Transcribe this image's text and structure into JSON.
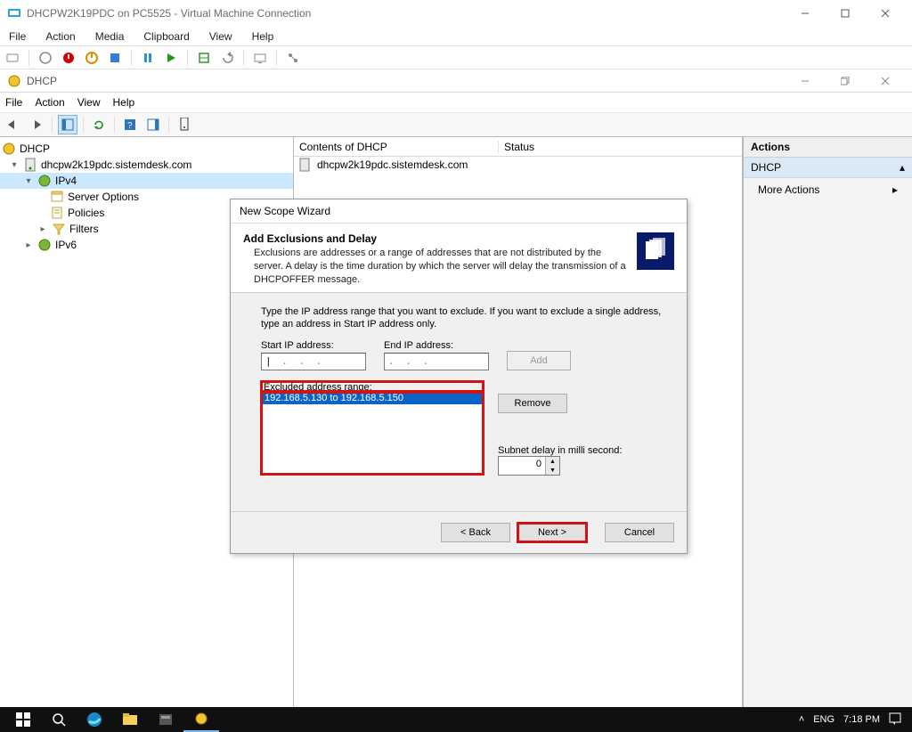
{
  "vm": {
    "title": "DHCPW2K19PDC on PC5525 - Virtual Machine Connection",
    "menu": [
      "File",
      "Action",
      "Media",
      "Clipboard",
      "View",
      "Help"
    ]
  },
  "dhcp": {
    "title": "DHCP",
    "menu": [
      "File",
      "Action",
      "View",
      "Help"
    ],
    "tree": {
      "root": "DHCP",
      "server": "dhcpw2k19pdc.sistemdesk.com",
      "ipv4": "IPv4",
      "server_options": "Server Options",
      "policies": "Policies",
      "filters": "Filters",
      "ipv6": "IPv6"
    },
    "content": {
      "header_col1": "Contents of DHCP",
      "header_col2": "Status",
      "row1": "dhcpw2k19pdc.sistemdesk.com"
    },
    "actions": {
      "title": "Actions",
      "section": "DHCP",
      "more": "More Actions"
    }
  },
  "wizard": {
    "title": "New Scope Wizard",
    "heading": "Add Exclusions and Delay",
    "desc": "Exclusions are addresses or a range of addresses that are not distributed by the server. A delay is the time duration by which the server will delay the transmission of a DHCPOFFER message.",
    "instruction": "Type the IP address range that you want to exclude. If you want to exclude a single address, type an address in Start IP address only.",
    "start_label": "Start IP address:",
    "end_label": "End IP address:",
    "add": "Add",
    "list_label": "Excluded address range:",
    "excluded": "192.168.5.130 to 192.168.5.150",
    "remove": "Remove",
    "subnet_label": "Subnet delay in milli second:",
    "subnet_value": "0",
    "back": "< Back",
    "next": "Next >",
    "cancel": "Cancel"
  },
  "taskbar": {
    "lang": "ENG",
    "time": "7:18 PM"
  }
}
